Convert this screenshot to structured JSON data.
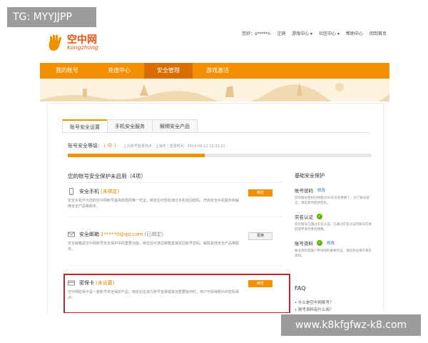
{
  "watermarks": {
    "top": "TG: MYYJJPP",
    "bottom": "www.k8kfgfwz-k8.com"
  },
  "logo": {
    "cn": "空中网",
    "en": "kongzhong"
  },
  "topnav": {
    "greeting": "您好：s*****n",
    "logout": "注销",
    "game_center": "游戏中心 ▾",
    "community": "社区中心 ▾",
    "help": "帮助中心",
    "back": "回到首页"
  },
  "mainnav": {
    "tabs": [
      "我的账号",
      "充值中心",
      "安全管理",
      "游戏激活"
    ],
    "active_index": 2
  },
  "subtabs": [
    "账号安全设置",
    "手机安全服务",
    "解绑安全产品"
  ],
  "security": {
    "level_label": "账号安全等级:",
    "level_value": "( 中 )",
    "last_login": "上次账号登录地点：上海市  |  登录时间：2014-08-12 15:31:11",
    "progress": 0.45
  },
  "protection": {
    "title": "您的账号安全保护未启用（4项）",
    "items": [
      {
        "name": "安全手机",
        "status": "(未绑定)",
        "desc": "安全手机作为您的空中网账号最高权限的唯一凭证，绑定后可轻松通过手机找回密码、开启安全手机服务和解绑安全产品等服务。",
        "button": "绑定"
      },
      {
        "name": "安全邮箱",
        "email": "1*****0@qq.com",
        "status": "(已绑定)",
        "desc": "安全邮箱是空中网账号安全保护中的重要功能，绑定后可通过邮箱直接找回账号密码，解除其他安全产品等服务。",
        "button": "更换"
      },
      {
        "name": "密保卡",
        "status": "(未设置)",
        "desc": "空中网密保卡是一套账号安全保护产品，绑定后在进行账号登录或其他重要操作时，用户可获得额外的密码保护。",
        "button": "绑定"
      }
    ]
  },
  "side": {
    "title": "基础安全保护",
    "items": [
      {
        "name": "账号密码",
        "link": "修改",
        "desc": "您的账号密码已经超过90天没有更换了，为了账号安全，请您及时修改密码。"
      },
      {
        "name": "实名认证",
        "link": "",
        "desc": "您的账号已通过实名认证，已通过实名认证的账号在找回或申诉时更有保障。"
      },
      {
        "name": "账号资料",
        "link": "修改",
        "desc": "账号资料是账户申诉时的重要凭证，请您务必填写真实资料。"
      }
    ]
  },
  "faq": {
    "title": "FAQ",
    "items": [
      "什么是空中网账号？",
      "账号资料有什么用？"
    ]
  },
  "colors": {
    "brand_orange": "#f39000",
    "highlight_red": "#c0272d"
  }
}
